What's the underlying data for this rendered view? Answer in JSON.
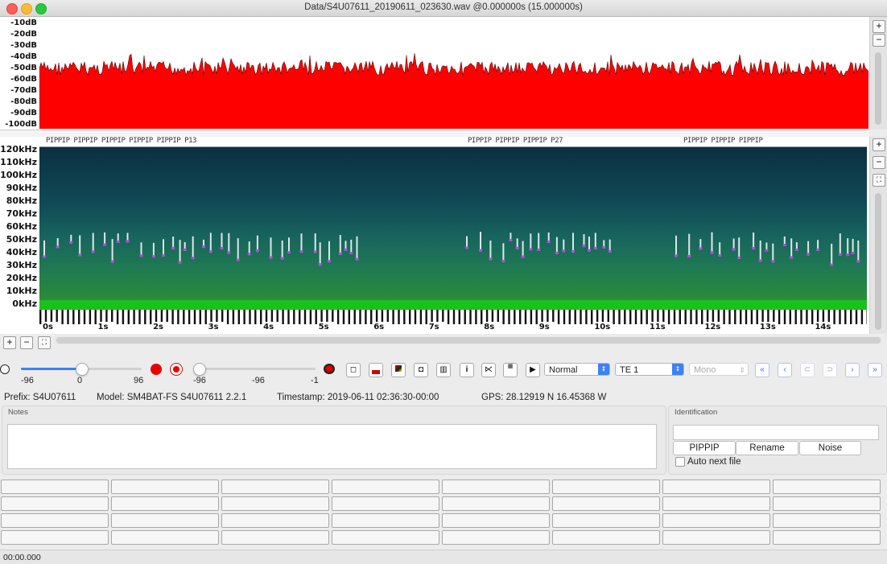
{
  "window": {
    "title": "Data/S4U07611_20190611_023630.wav @0.000000s (15.000000s)"
  },
  "waveform": {
    "db_labels": [
      "-10dB",
      "-20dB",
      "-30dB",
      "-40dB",
      "-50dB",
      "-60dB",
      "-70dB",
      "-80dB",
      "-90dB",
      "-100dB"
    ],
    "color": "#ff0000",
    "zoom_in": "+",
    "zoom_out": "−"
  },
  "spectrogram": {
    "freq_labels": [
      "120kHz",
      "110kHz",
      "100kHz",
      "90kHz",
      "80kHz",
      "70kHz",
      "60kHz",
      "50kHz",
      "40kHz",
      "30kHz",
      "20kHz",
      "10kHz",
      "0kHz"
    ],
    "annotation_labels": [
      "PIPPIP PIPPIP PIPPIP PIPPIP PIPPIP P13",
      "PIPPIP PIPPIP PIPPIP P27",
      "PIPPIP PIPPIP PIPPIP"
    ],
    "time_labels": [
      "0s",
      "1s",
      "2s",
      "3s",
      "4s",
      "5s",
      "6s",
      "7s",
      "8s",
      "9s",
      "10s",
      "11s",
      "12s",
      "13s",
      "14s"
    ],
    "zoom_in": "+",
    "zoom_out": "−",
    "fit": "⛶"
  },
  "bottom_zoom": {
    "in": "+",
    "out": "−",
    "fit": "⛶"
  },
  "controls": {
    "slider1": {
      "min_label": "-96",
      "value_label": "0",
      "max_label": "96",
      "value_fraction": 0.5
    },
    "slider2": {
      "min_label": "-96",
      "value_label": "-96",
      "max_label": "-1",
      "value_fraction": 0.0
    },
    "mode_select": "Normal",
    "te_select": "TE   1",
    "channel_select": "Mono",
    "record_color": "#e60000"
  },
  "info": {
    "prefix": "Prefix: S4U07611",
    "model": "Model: SM4BAT-FS S4U07611 2.2.1",
    "timestamp": "Timestamp: 2019-06-11 02:36:30-00:00",
    "gps": "GPS:  28.12919 N 16.45368 W"
  },
  "notes": {
    "label": "Notes",
    "value": ""
  },
  "identification": {
    "label": "Identification",
    "value": "",
    "buttons": [
      "PIPPIP",
      "Rename",
      "Noise"
    ],
    "auto_next_label": "Auto next file",
    "auto_next_checked": false
  },
  "status": {
    "time": "00:00.000"
  }
}
